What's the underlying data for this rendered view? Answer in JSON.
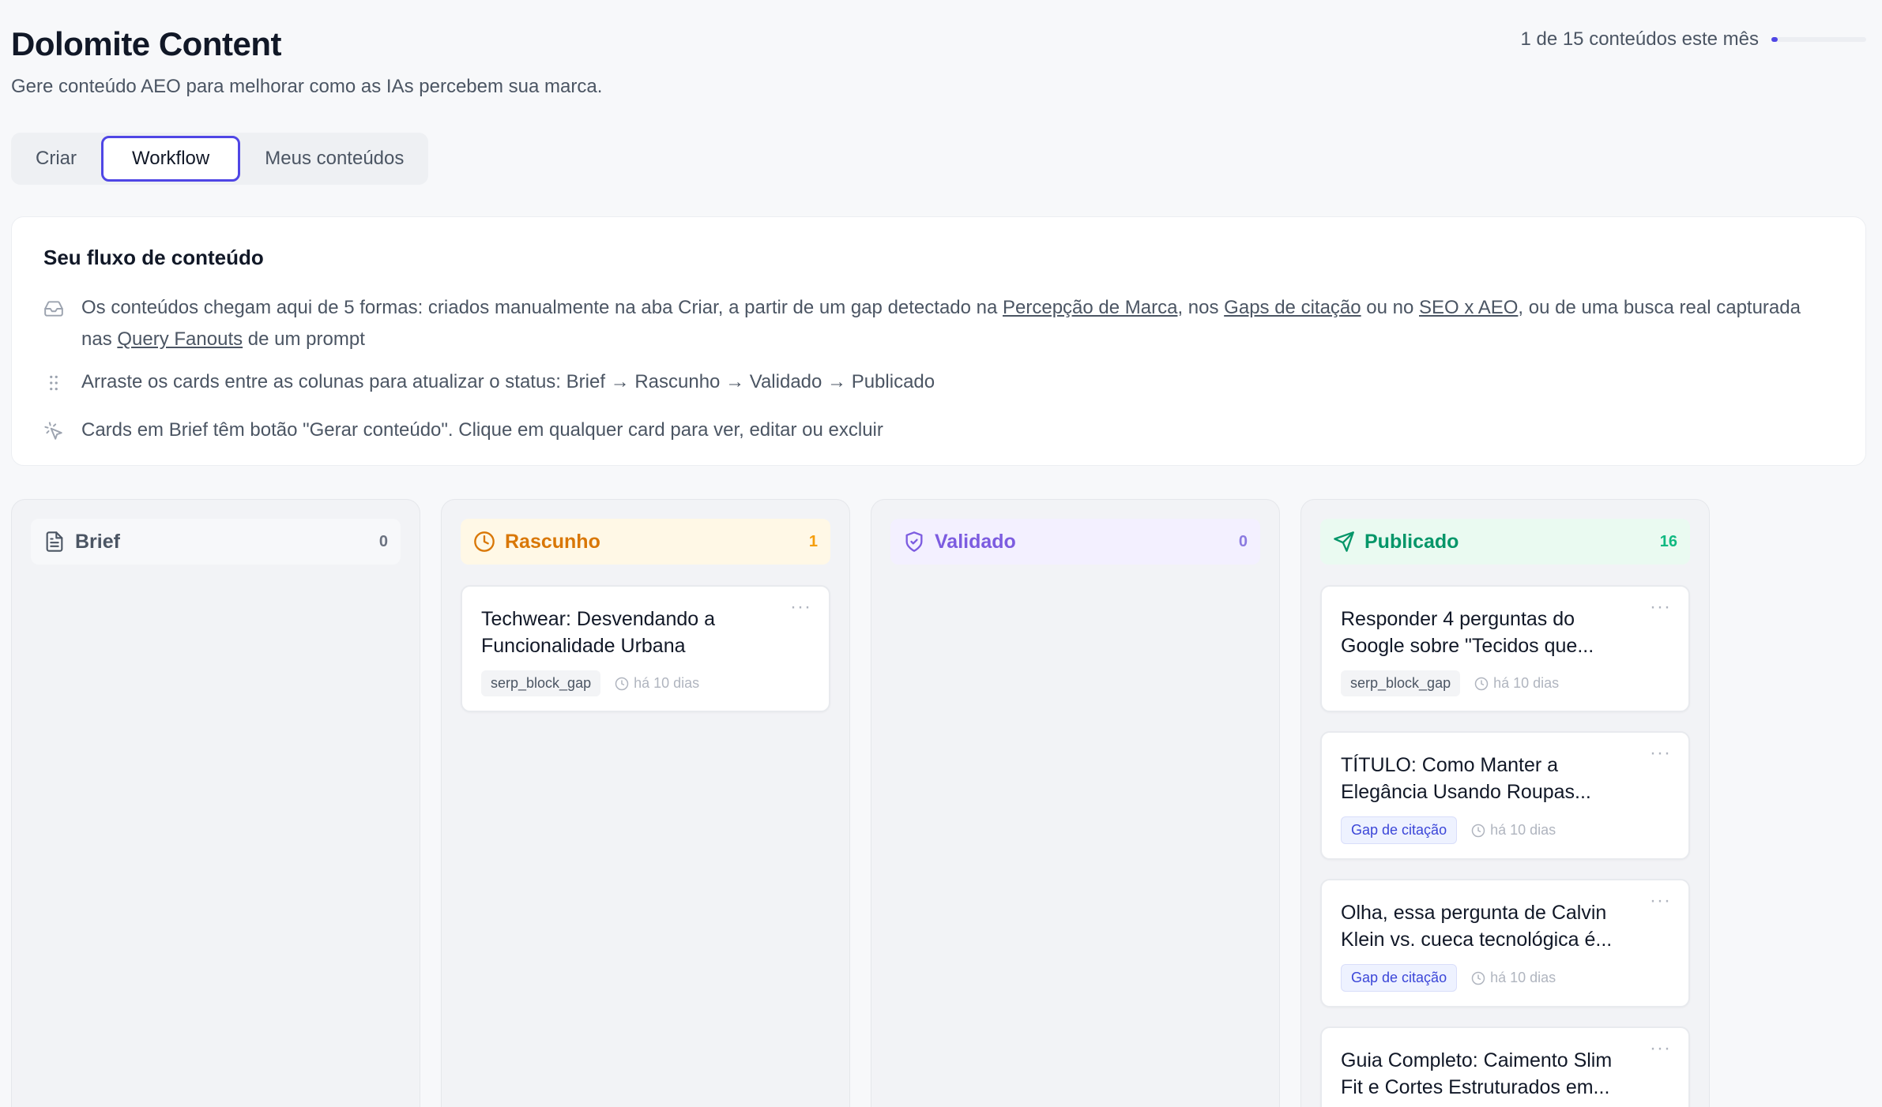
{
  "header": {
    "title": "Dolomite Content",
    "subtitle": "Gere conteúdo AEO para melhorar como as IAs percebem sua marca.",
    "quota_text": "1 de 15 conteúdos este mês",
    "quota_fraction": 0.067
  },
  "tabs": [
    {
      "label": "Criar"
    },
    {
      "label": "Workflow"
    },
    {
      "label": "Meus conteúdos"
    }
  ],
  "info": {
    "title": "Seu fluxo de conteúdo",
    "row1": {
      "t1": "Os conteúdos chegam aqui de 5 formas: criados manualmente na aba Criar, a partir de um gap detectado na ",
      "l1": "Percepção de Marca",
      "t2": ", nos ",
      "l2": "Gaps de citação",
      "t3": " ou no ",
      "l3": "SEO x AEO",
      "t4": ", ou de uma busca real capturada nas ",
      "l4": "Query Fanouts",
      "t5": " de um prompt"
    },
    "row2": "Arraste os cards entre as colunas para atualizar o status: Brief → Rascunho → Validado → Publicado",
    "row3": "Cards em Brief têm botão \"Gerar conteúdo\". Clique em qualquer card para ver, editar ou excluir"
  },
  "columns": {
    "brief": {
      "name": "Brief",
      "count": "0"
    },
    "rascunho": {
      "name": "Rascunho",
      "count": "1",
      "cards": [
        {
          "title": "Techwear: Desvendando a Funcionalidade Urbana",
          "tag": "serp_block_gap",
          "time": "há 10 dias"
        }
      ]
    },
    "validado": {
      "name": "Validado",
      "count": "0"
    },
    "publicado": {
      "name": "Publicado",
      "count": "16",
      "cards": [
        {
          "title": "Responder 4 perguntas do Google sobre \"Tecidos que...",
          "tag": "serp_block_gap",
          "time": "há 10 dias"
        },
        {
          "title": "TÍTULO: Como Manter a Elegância Usando Roupas...",
          "tag": "Gap de citação",
          "time": "há 10 dias"
        },
        {
          "title": "Olha, essa pergunta de Calvin Klein vs. cueca tecnológica é...",
          "tag": "Gap de citação",
          "time": "há 10 dias"
        },
        {
          "title": "Guia Completo: Caimento Slim Fit e Cortes Estruturados em...",
          "tag": "",
          "time": ""
        }
      ]
    }
  },
  "more_label": "···",
  "colors": {
    "accent": "#4f46e5",
    "rascunho": "#d97706",
    "validado": "#7c5ce0",
    "publicado": "#059669"
  }
}
